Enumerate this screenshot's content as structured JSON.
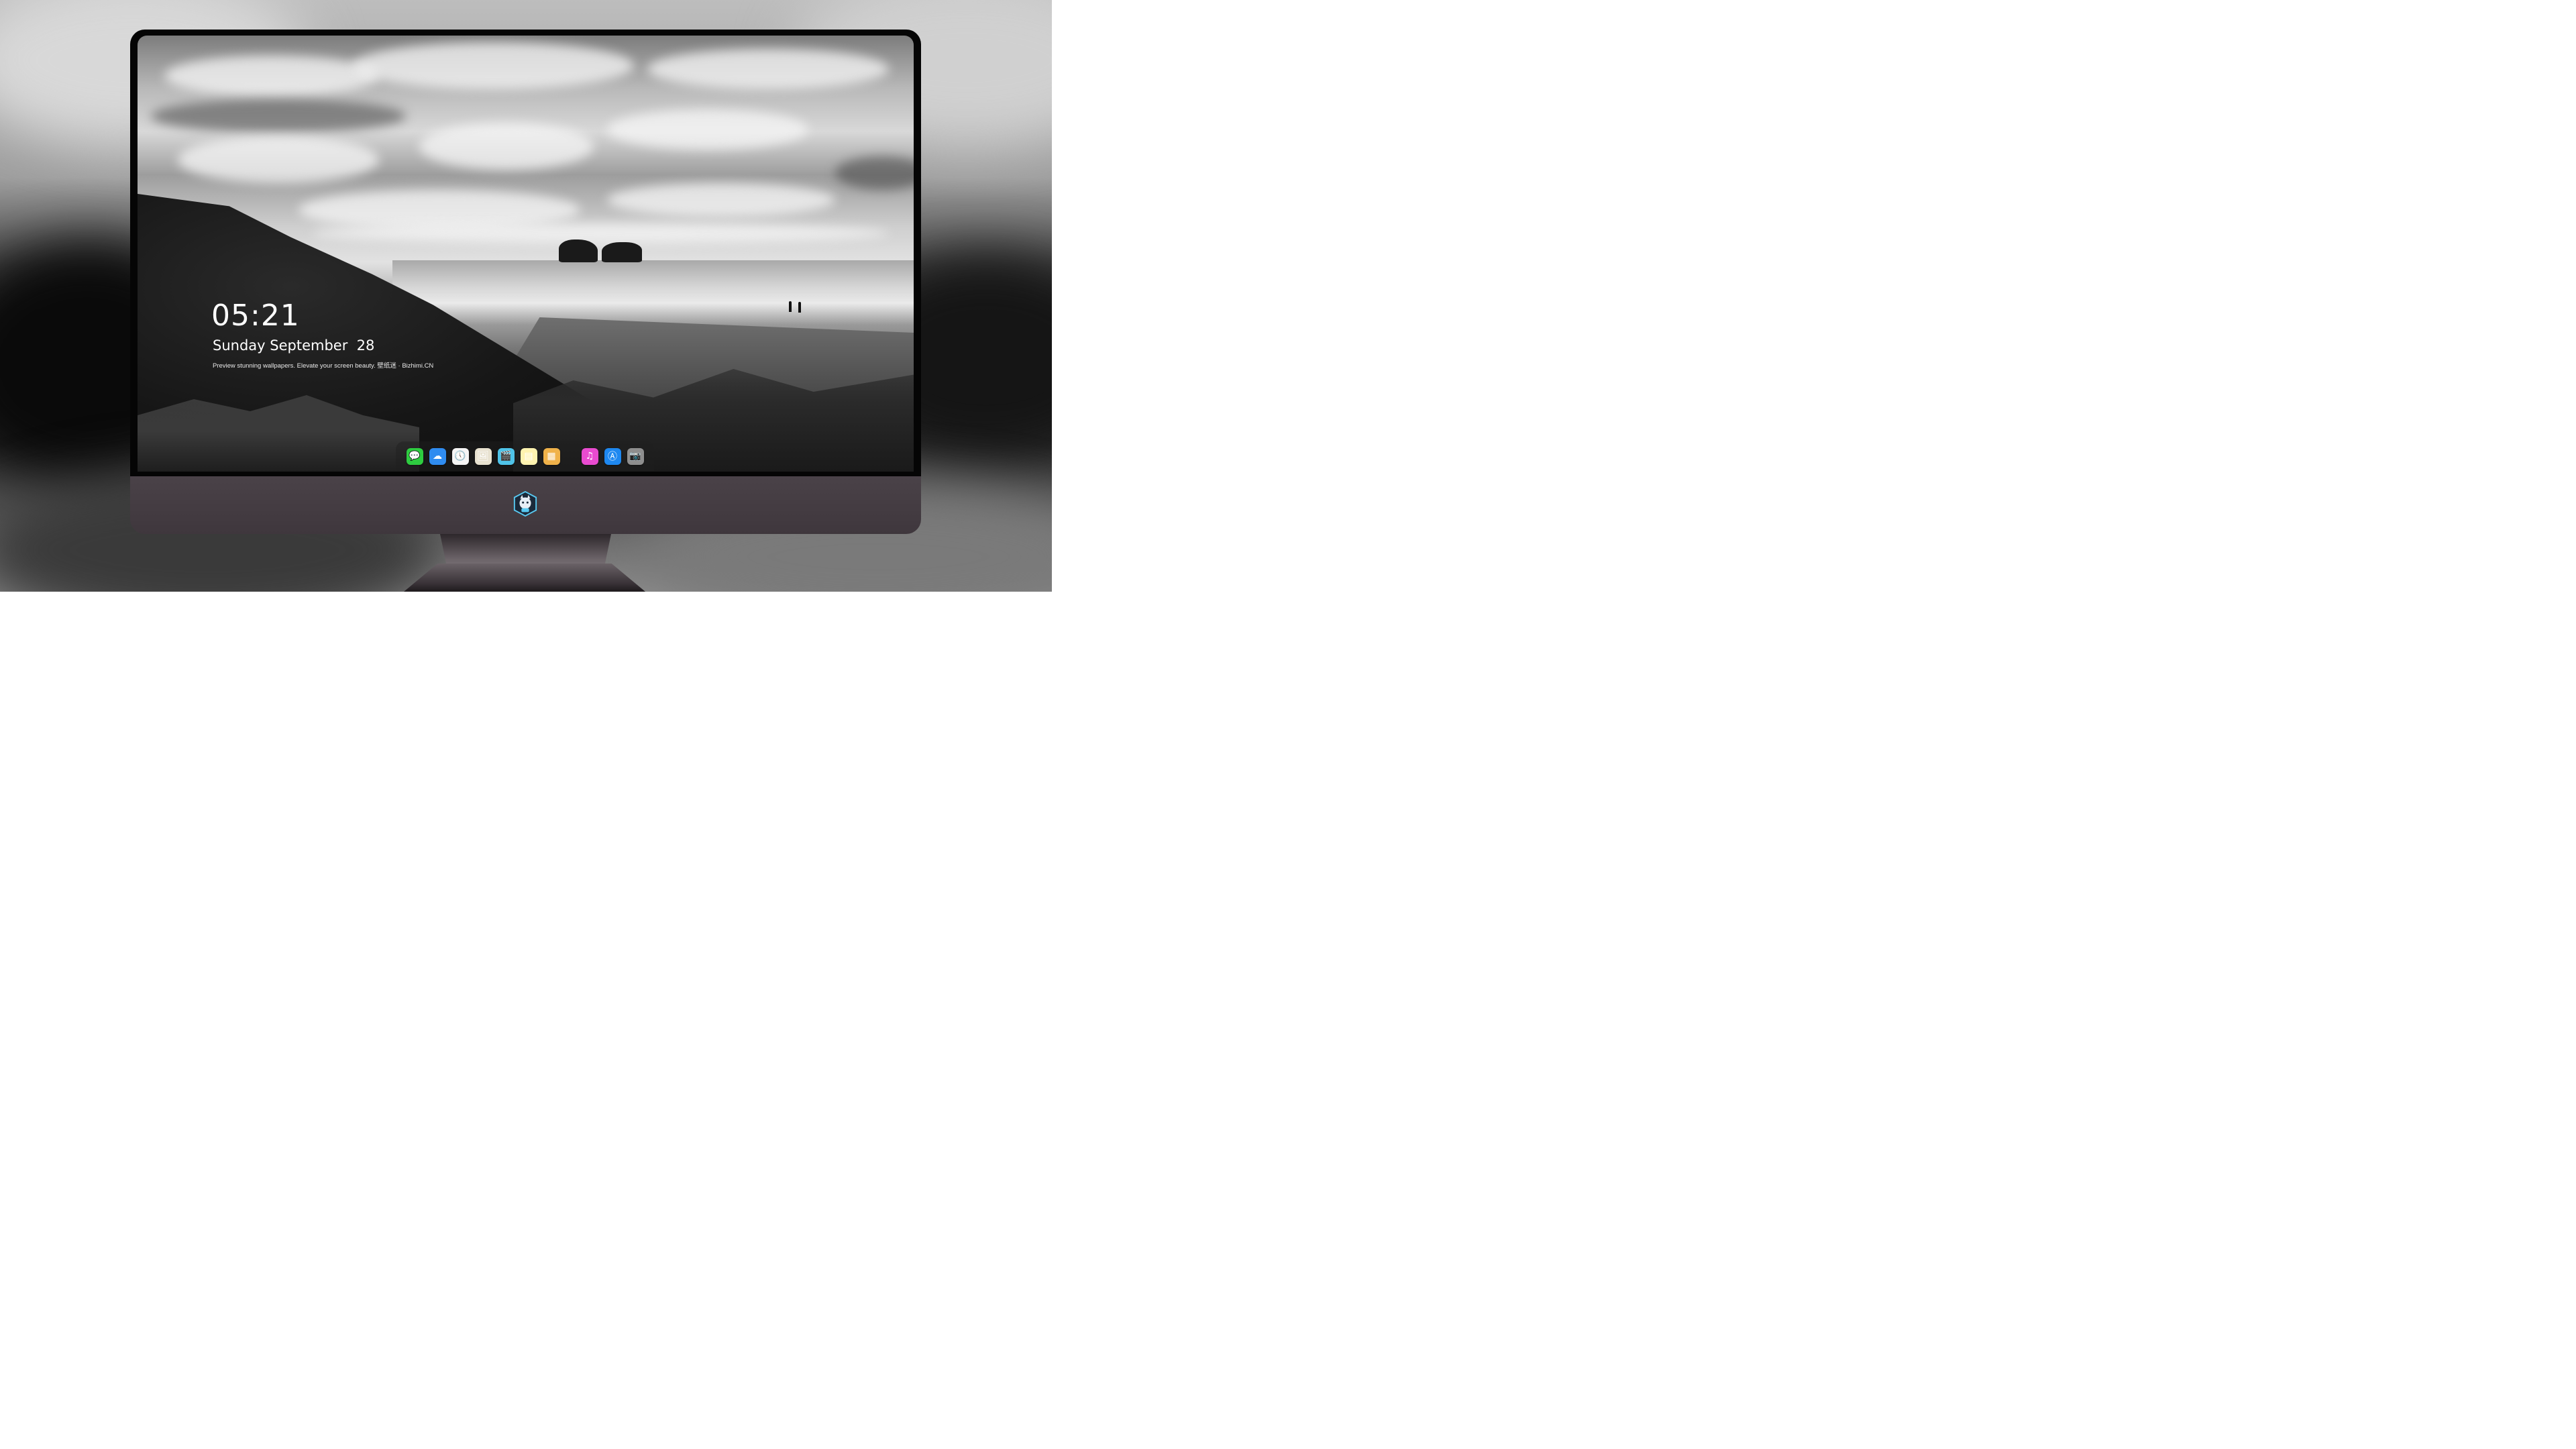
{
  "lock_screen": {
    "time": "05:21",
    "date": "Sunday September  28",
    "caption": "Preview stunning wallpapers. Elevate your screen beauty. 壁纸迷 · Bizhimi.CN"
  },
  "dock": {
    "items": [
      {
        "name": "messages-icon",
        "color": "#2ecc40",
        "glyph": "💬"
      },
      {
        "name": "weather-icon",
        "color": "#2f8cf0",
        "glyph": "☁"
      },
      {
        "name": "clock-icon",
        "color": "#f5f5f5",
        "glyph": "🕔"
      },
      {
        "name": "preview-icon",
        "color": "#e8e2d0",
        "glyph": "🖼"
      },
      {
        "name": "claquette-icon",
        "color": "#4fc3e8",
        "glyph": "🎬"
      },
      {
        "name": "notes-icon",
        "color": "#fff3b0",
        "glyph": "▤"
      },
      {
        "name": "photo-booth-icon",
        "color": "#f0b24a",
        "glyph": "▦"
      },
      {
        "name": "itunes-icon",
        "color": "#e94bd0",
        "glyph": "♫"
      },
      {
        "name": "app-store-icon",
        "color": "#1e88f0",
        "glyph": "Ⓐ"
      },
      {
        "name": "camera-icon",
        "color": "#8e8e8e",
        "glyph": "📷"
      }
    ]
  },
  "brand_logo": "mascot-logo-icon"
}
